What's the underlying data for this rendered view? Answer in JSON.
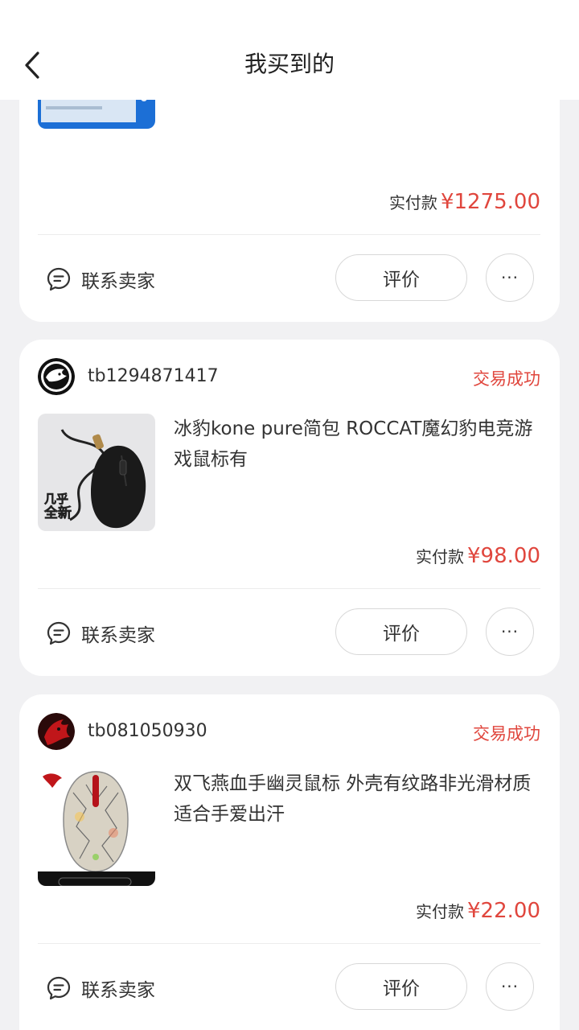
{
  "header": {
    "title": "我买到的"
  },
  "common": {
    "paid_label": "实付款",
    "contact_label": "联系卖家",
    "review_label": "评价",
    "more_label": "···",
    "status_success": "交易成功"
  },
  "orders": [
    {
      "price": "¥1275.00"
    },
    {
      "seller": "tb1294871417",
      "status": "交易成功",
      "title": "冰豹kone pure简包 ROCCAT魔幻豹电竞游戏鼠标有",
      "price": "¥98.00",
      "thumb_badge": "几乎全新"
    },
    {
      "seller": "tb081050930",
      "status": "交易成功",
      "title": "双飞燕血手幽灵鼠标 外壳有纹路非光滑材质 适合手爱出汗",
      "price": "¥22.00"
    }
  ],
  "colors": {
    "accent": "#e0463d",
    "background": "#f1f1f3"
  }
}
